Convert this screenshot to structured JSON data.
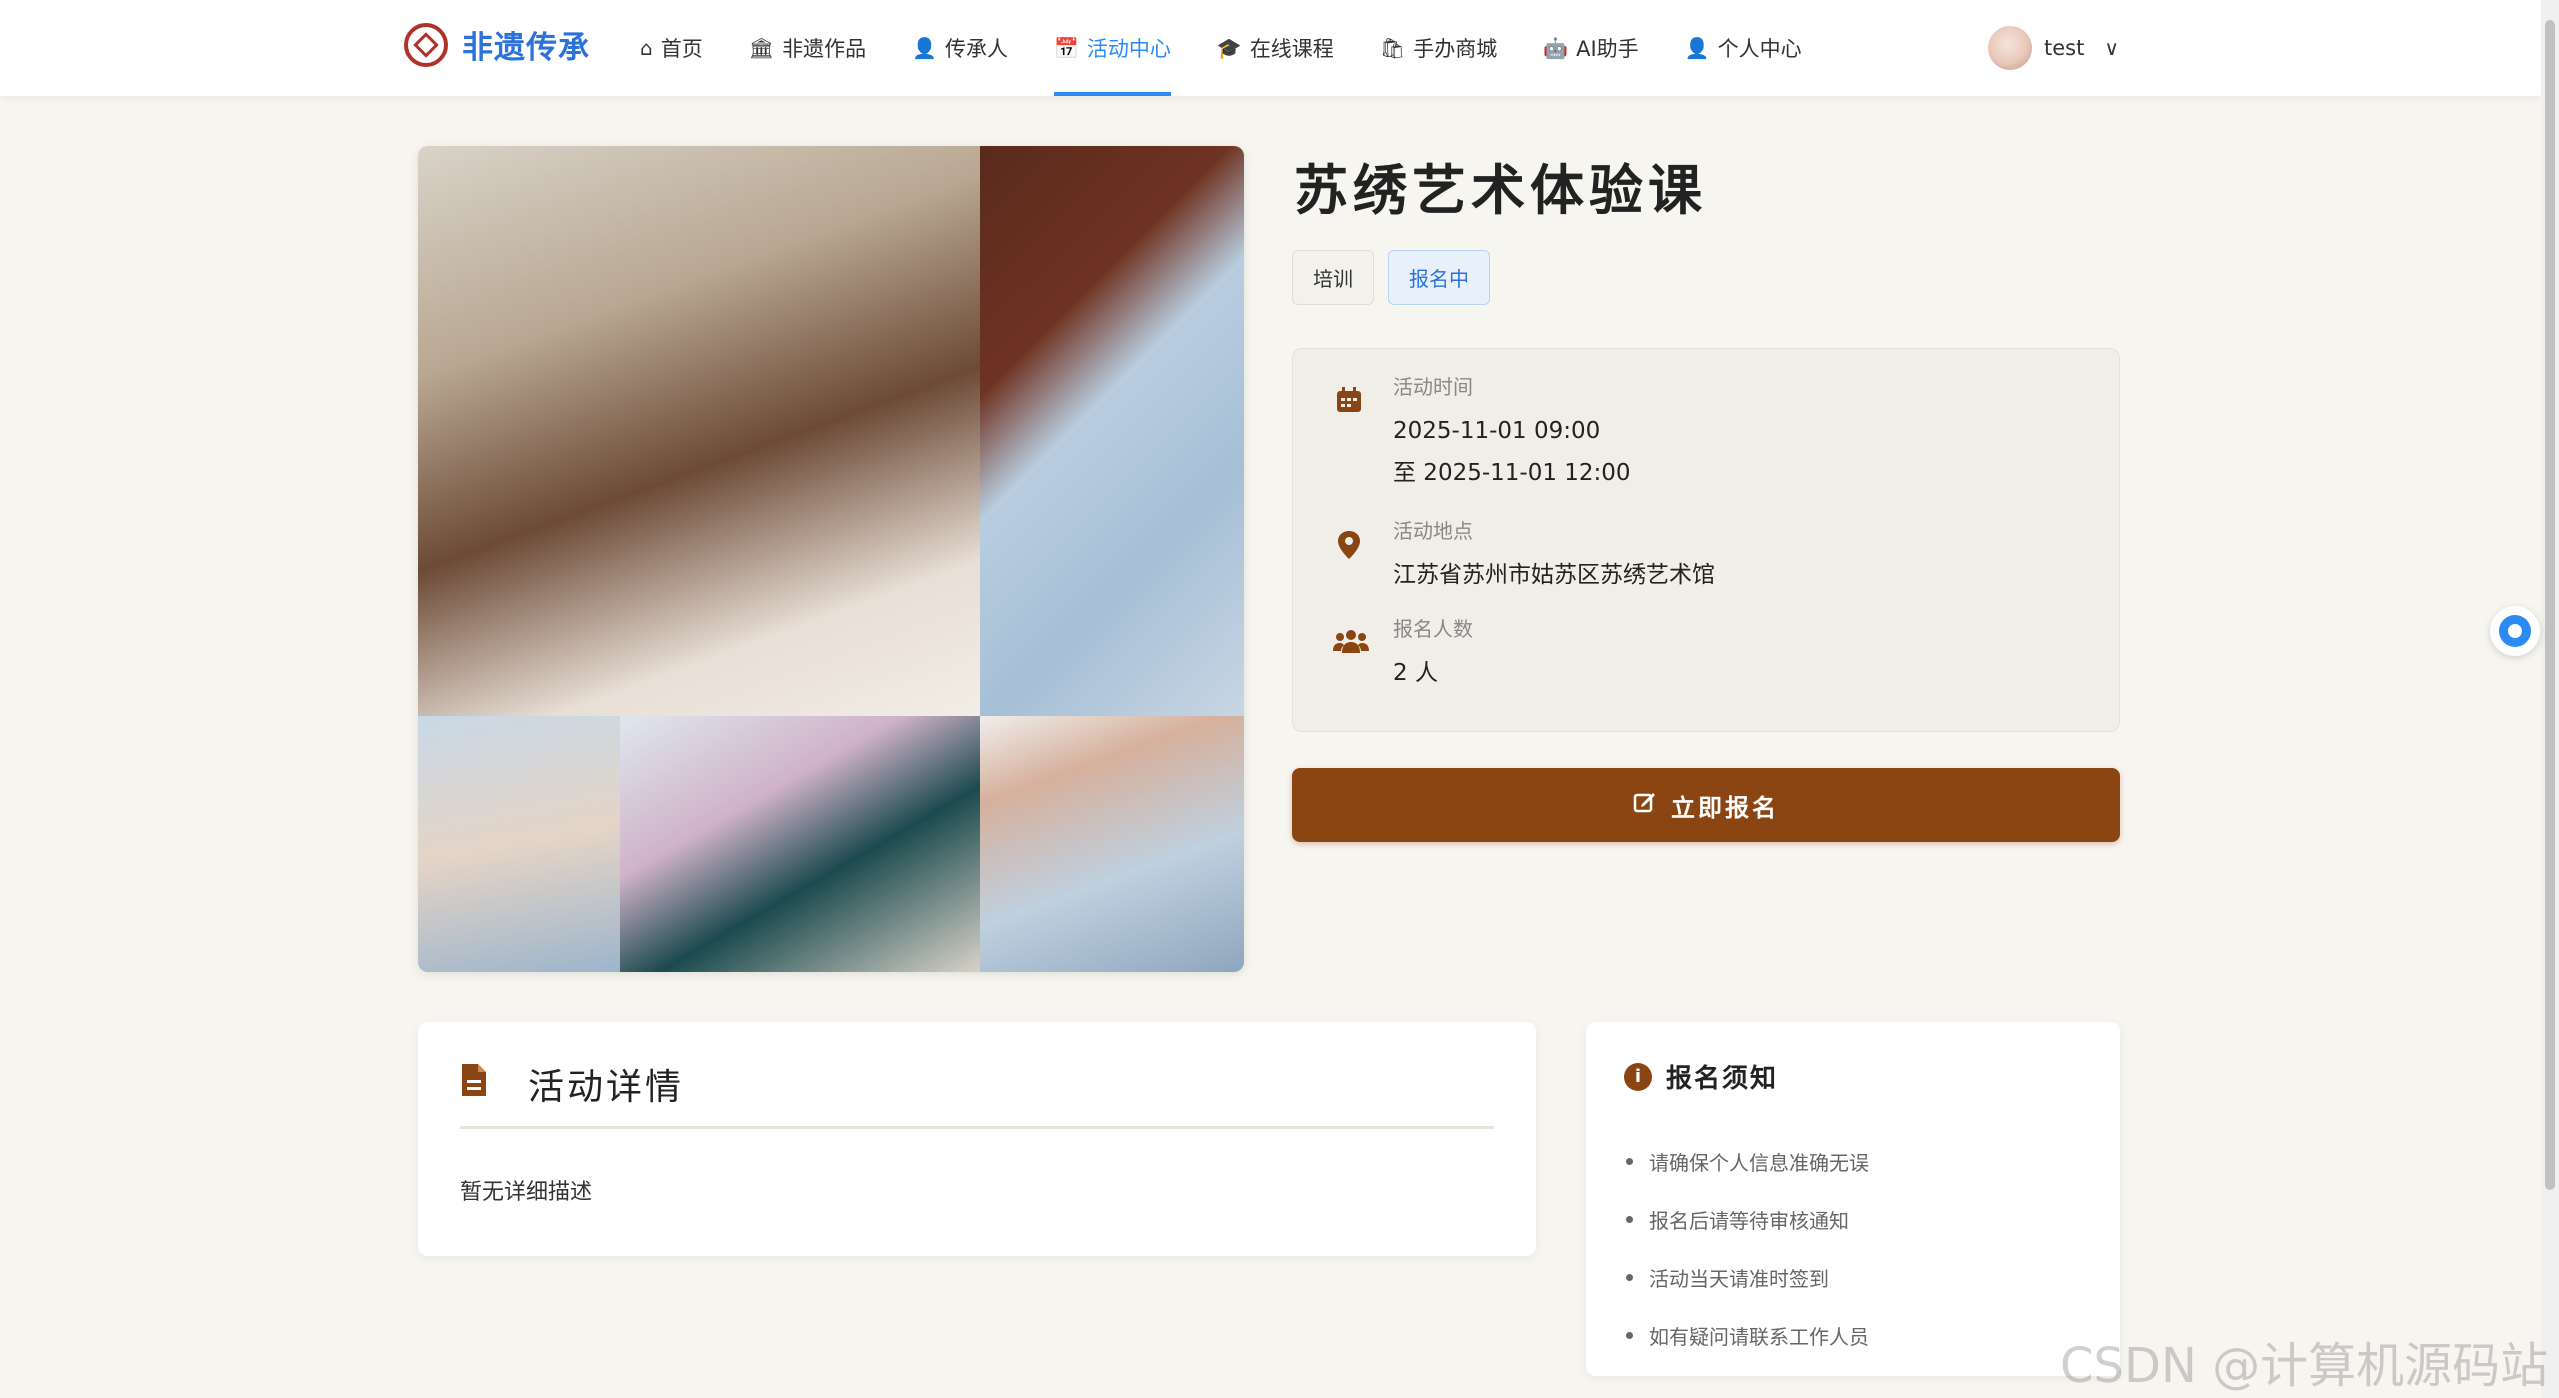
{
  "brand": {
    "name": "非遗传承"
  },
  "nav": {
    "items": [
      {
        "label": "首页",
        "icon": "home-icon",
        "glyph": "⌂"
      },
      {
        "label": "非遗作品",
        "icon": "museum-icon",
        "glyph": "🏛"
      },
      {
        "label": "传承人",
        "icon": "user-icon",
        "glyph": "👤"
      },
      {
        "label": "活动中心",
        "icon": "calendar-icon",
        "glyph": "📅",
        "active": true
      },
      {
        "label": "在线课程",
        "icon": "graduation-cap-icon",
        "glyph": "🎓"
      },
      {
        "label": "手办商城",
        "icon": "shopping-bag-icon",
        "glyph": "🛍"
      },
      {
        "label": "AI助手",
        "icon": "robot-icon",
        "glyph": "🤖"
      },
      {
        "label": "个人中心",
        "icon": "person-icon",
        "glyph": "👤"
      }
    ]
  },
  "user": {
    "name": "test"
  },
  "activity": {
    "title": "苏绣艺术体验课",
    "tags": [
      {
        "label": "培训"
      },
      {
        "label": "报名中"
      }
    ],
    "time_label": "活动时间",
    "time_start": "2025-11-01 09:00",
    "time_end": "至 2025-11-01 12:00",
    "location_label": "活动地点",
    "location": "江苏省苏州市姑苏区苏绣艺术馆",
    "count_label": "报名人数",
    "count": "2 人",
    "signup_label": "立即报名"
  },
  "detail": {
    "title": "活动详情",
    "body": "暂无详细描述"
  },
  "notice": {
    "title": "报名须知",
    "items": [
      "请确保个人信息准确无误",
      "报名后请等待审核通知",
      "活动当天请准时签到",
      "如有疑问请联系工作人员"
    ]
  },
  "watermark": "CSDN @计算机源码站",
  "colors": {
    "accent": "#8b4513",
    "nav_active": "#2b8bf2",
    "brand": "#2b73d9"
  }
}
